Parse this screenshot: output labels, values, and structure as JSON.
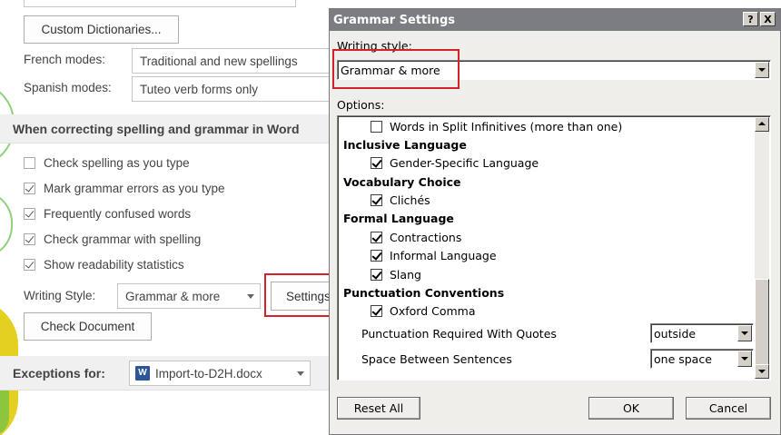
{
  "word_options": {
    "custom_dictionaries_button": "Custom Dictionaries...",
    "french_modes": {
      "label": "French modes:",
      "value": "Traditional and new spellings"
    },
    "spanish_modes": {
      "label": "Spanish modes:",
      "value": "Tuteo verb forms only"
    },
    "section_title": "When correcting spelling and grammar in Word",
    "checkboxes": [
      {
        "label": "Check spelling as you type",
        "checked": false
      },
      {
        "label": "Mark grammar errors as you type",
        "checked": true
      },
      {
        "label": "Frequently confused words",
        "checked": true
      },
      {
        "label": "Check grammar with spelling",
        "checked": true
      },
      {
        "label": "Show readability statistics",
        "checked": true
      }
    ],
    "writing_style": {
      "label": "Writing Style:",
      "value": "Grammar & more"
    },
    "settings_button": "Settings...",
    "check_document_button": "Check Document",
    "exceptions": {
      "label": "Exceptions for:",
      "file": "Import-to-D2H.docx"
    }
  },
  "grammar_dialog": {
    "title": "Grammar Settings",
    "help_btn": "?",
    "close_btn": "X",
    "writing_style_label": "Writing style:",
    "writing_style_value": "Grammar & more",
    "options_label": "Options:",
    "items": {
      "split_infinitives": {
        "label": "Words in Split Infinitives (more than one)",
        "checked": false
      },
      "inclusive_language": "Inclusive Language",
      "gender_specific": {
        "label": "Gender-Specific Language",
        "checked": true
      },
      "vocabulary_choice": "Vocabulary Choice",
      "cliches": {
        "label": "Clichés",
        "checked": true
      },
      "formal_language": "Formal Language",
      "contractions": {
        "label": "Contractions",
        "checked": true
      },
      "informal_language": {
        "label": "Informal Language",
        "checked": true
      },
      "slang": {
        "label": "Slang",
        "checked": true
      },
      "punctuation_conventions": "Punctuation Conventions",
      "oxford_comma": {
        "label": "Oxford Comma",
        "checked": true
      },
      "punct_quotes": {
        "label": "Punctuation Required With Quotes",
        "value": "outside"
      },
      "space_sentences": {
        "label": "Space Between Sentences",
        "value": "one space"
      }
    },
    "reset_all": "Reset All",
    "ok": "OK",
    "cancel": "Cancel"
  },
  "colors": {
    "highlight": "#d4212a",
    "titlebar": "#7c7d82",
    "dialog_bg": "#efeeea"
  }
}
